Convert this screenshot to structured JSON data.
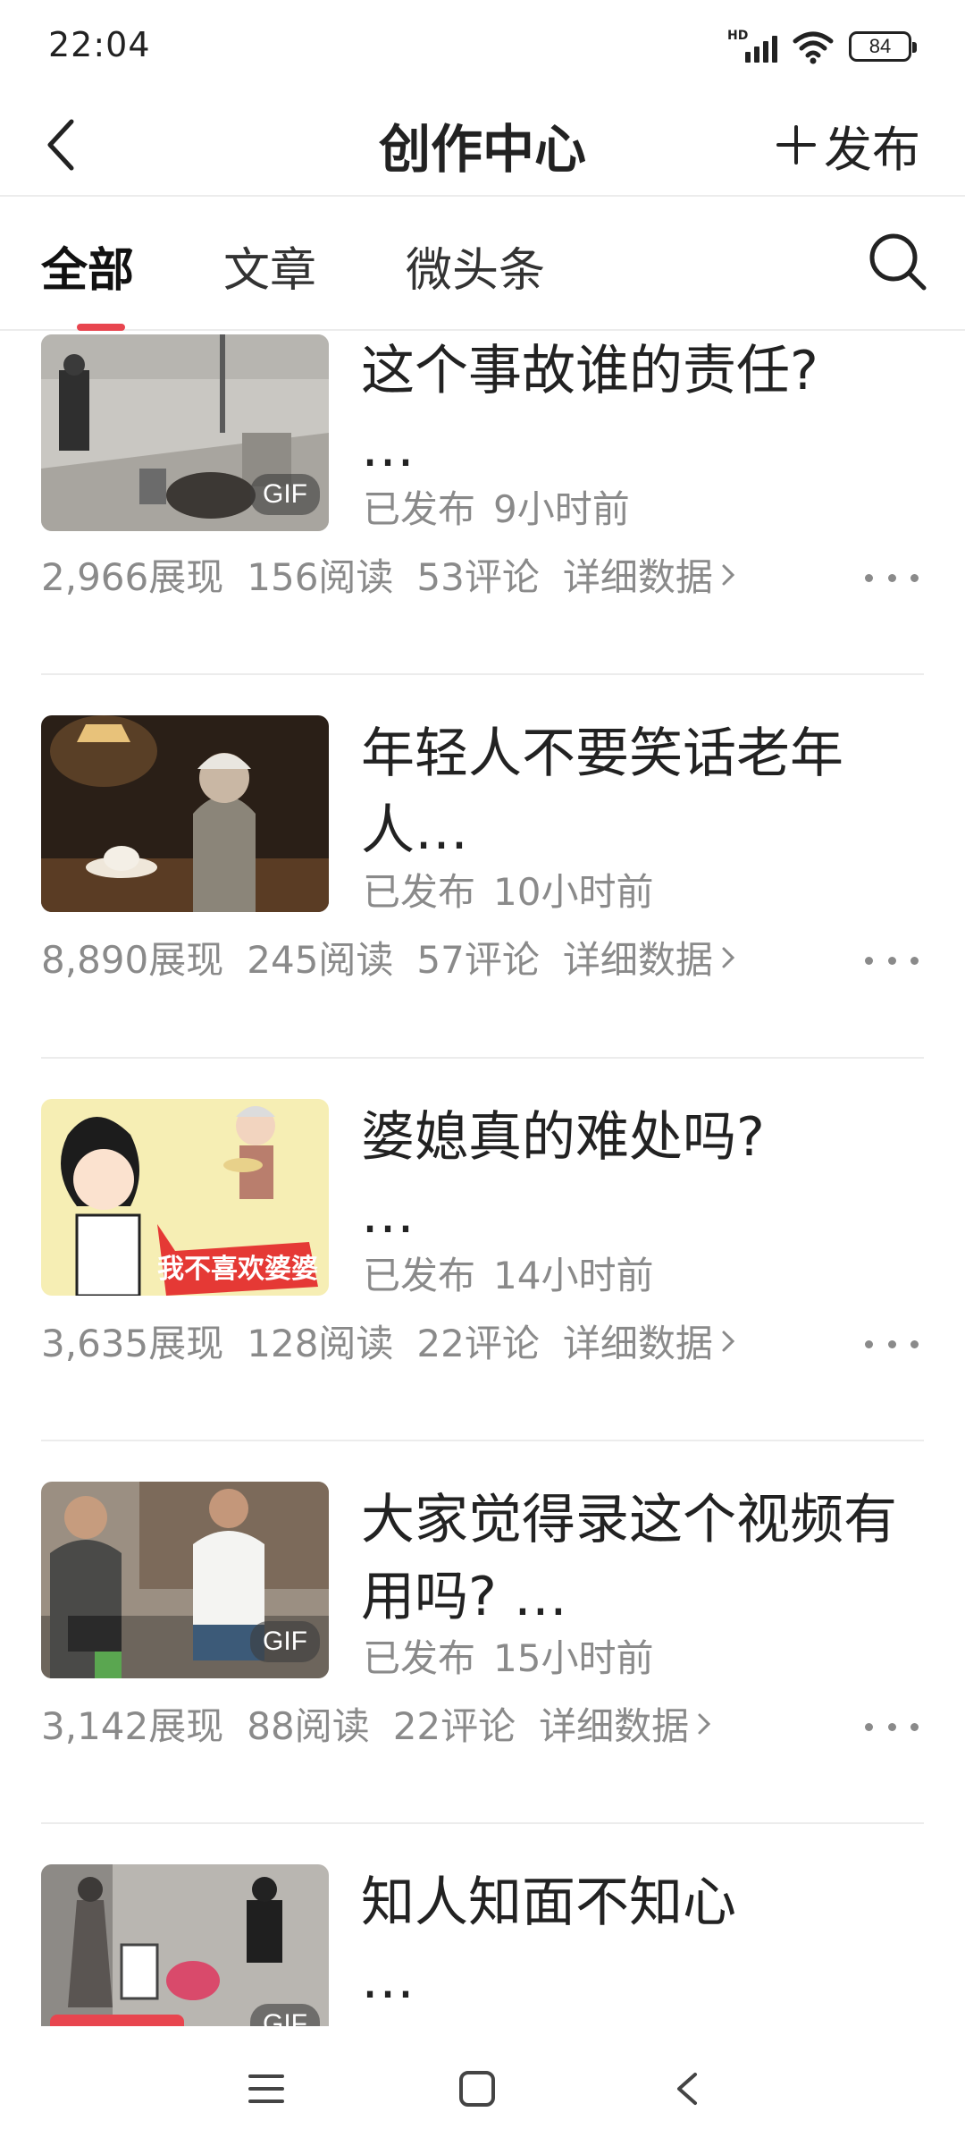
{
  "status_bar": {
    "time": "22:04",
    "network": "HD",
    "battery": "84"
  },
  "header": {
    "title": "创作中心",
    "publish_label": "发布"
  },
  "tabs": [
    {
      "label": "全部",
      "active": true
    },
    {
      "label": "文章",
      "active": false
    },
    {
      "label": "微头条",
      "active": false
    }
  ],
  "accent_color": "#e8454f",
  "posts": [
    {
      "title": "这个事故谁的责任?\n…",
      "status": "已发布",
      "time": "9小时前",
      "impressions": "2,966展现",
      "reads": "156阅读",
      "comments": "53评论",
      "detail_label": "详细数据",
      "badge": "GIF"
    },
    {
      "title": "年轻人不要笑话老年人…",
      "status": "已发布",
      "time": "10小时前",
      "impressions": "8,890展现",
      "reads": "245阅读",
      "comments": "57评论",
      "detail_label": "详细数据"
    },
    {
      "title": "婆媳真的难处吗?\n…",
      "status": "已发布",
      "time": "14小时前",
      "impressions": "3,635展现",
      "reads": "128阅读",
      "comments": "22评论",
      "detail_label": "详细数据",
      "thumb_text": "我不喜欢婆婆"
    },
    {
      "title": "大家觉得录这个视频有用吗? …",
      "status": "已发布",
      "time": "15小时前",
      "impressions": "3,142展现",
      "reads": "88阅读",
      "comments": "22评论",
      "detail_label": "详细数据",
      "badge": "GIF"
    },
    {
      "title": "知人知面不知心\n…",
      "badge": "GIF"
    }
  ]
}
